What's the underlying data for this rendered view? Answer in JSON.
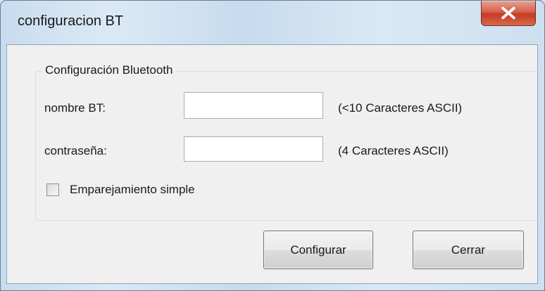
{
  "window": {
    "title": "configuracion BT"
  },
  "group": {
    "title": "Configuración Bluetooth"
  },
  "fields": {
    "name": {
      "label": "nombre BT:",
      "value": "",
      "hint": "(<10 Caracteres ASCII)"
    },
    "password": {
      "label": "contraseña:",
      "value": "",
      "hint": "(4 Caracteres ASCII)"
    }
  },
  "options": {
    "simple_pairing": {
      "label": "Emparejamiento simple",
      "checked": false
    }
  },
  "buttons": {
    "configure": "Configurar",
    "close": "Cerrar"
  },
  "icons": {
    "close": "close-x-icon"
  },
  "colors": {
    "close_button": "#c43a22",
    "client_bg": "#f0f0f0",
    "frame": "#cfe0f1"
  }
}
